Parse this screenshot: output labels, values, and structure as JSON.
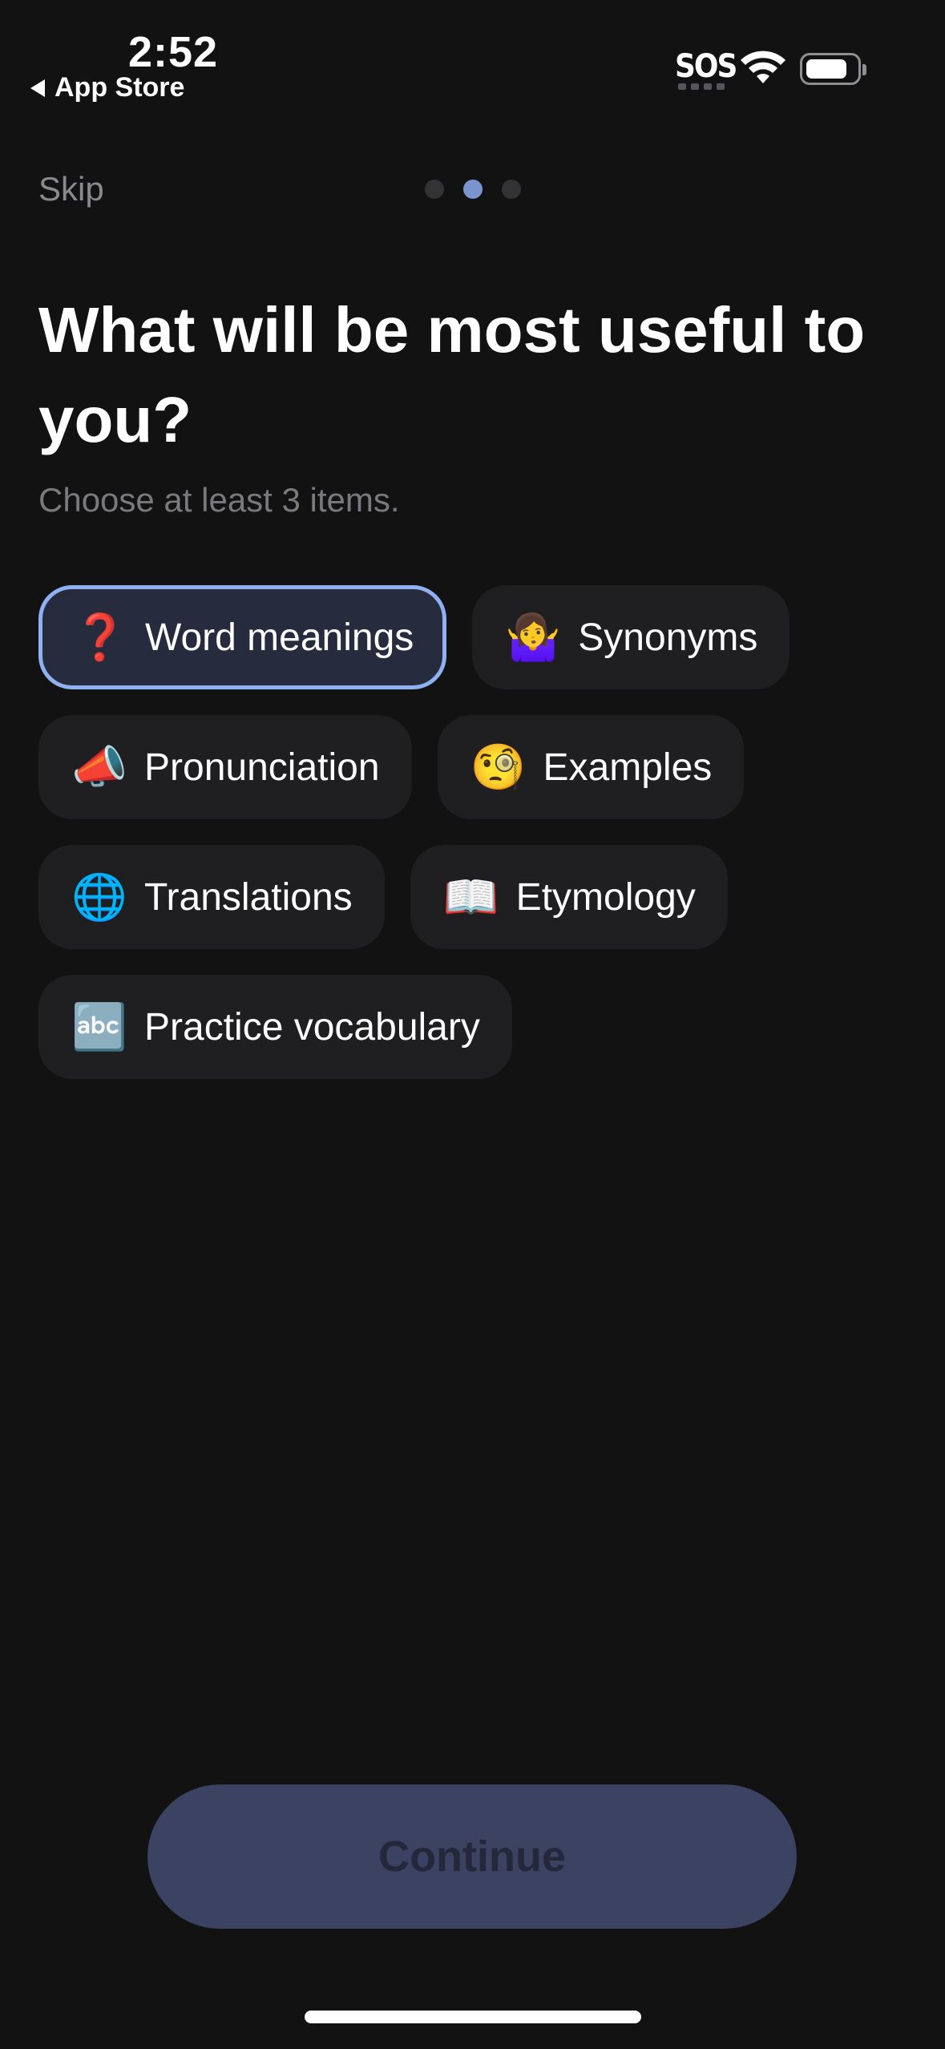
{
  "status_bar": {
    "time": "2:52",
    "back_label": "App Store",
    "sos": "SOS"
  },
  "onboarding": {
    "skip_label": "Skip",
    "step_count": 3,
    "current_step": 2,
    "title": "What will be most useful to you?",
    "subtitle": "Choose at least 3 items.",
    "options": [
      {
        "emoji": "❓",
        "icon": "question-mark-icon",
        "label": "Word meanings",
        "selected": true
      },
      {
        "emoji": "🤷‍♀️",
        "icon": "shrug-icon",
        "label": "Synonyms",
        "selected": false
      },
      {
        "emoji": "📣",
        "icon": "megaphone-icon",
        "label": "Pronunciation",
        "selected": false
      },
      {
        "emoji": "🧐",
        "icon": "monocle-face-icon",
        "label": "Examples",
        "selected": false
      },
      {
        "emoji": "🌐",
        "icon": "globe-icon",
        "label": "Translations",
        "selected": false
      },
      {
        "emoji": "📖",
        "icon": "open-book-icon",
        "label": "Etymology",
        "selected": false
      },
      {
        "emoji": "🔤",
        "icon": "abc-icon",
        "label": "Practice vocabulary",
        "selected": false
      }
    ],
    "continue_label": "Continue"
  },
  "colors": {
    "background": "#121213",
    "selected_border": "#8fb1f2",
    "active_dot": "#7b93cf",
    "button_disabled": "#3b4262"
  }
}
